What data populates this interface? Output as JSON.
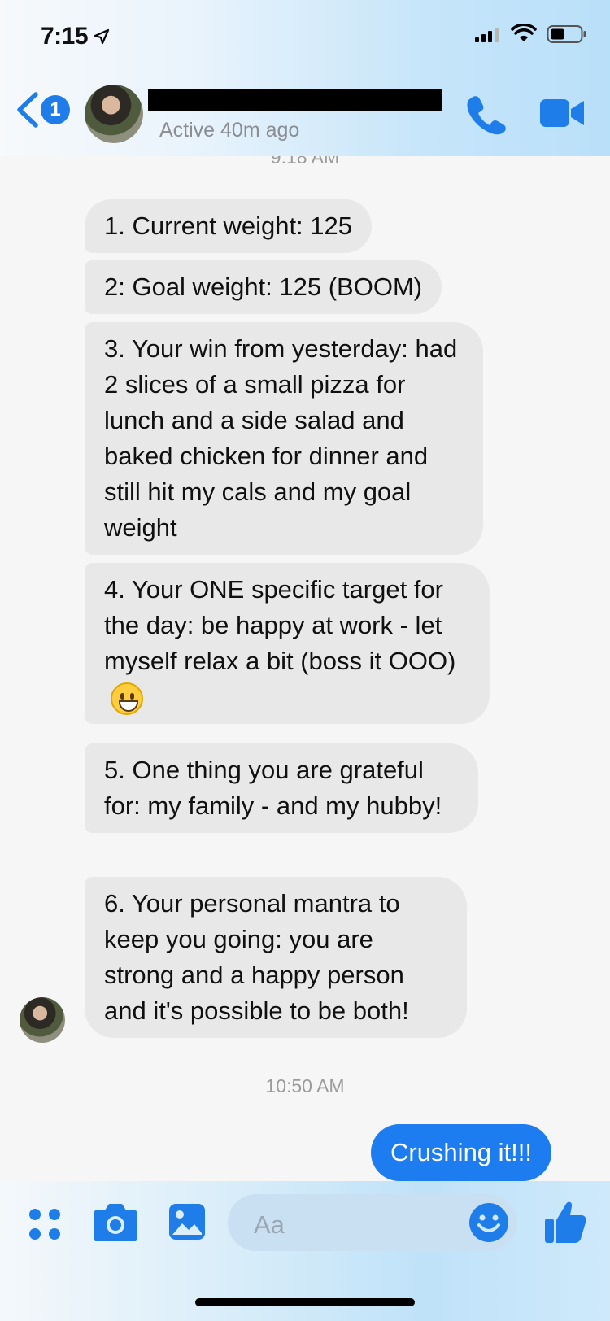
{
  "status_bar": {
    "time": "7:15"
  },
  "header": {
    "back_badge": "1",
    "active_status": "Active 40m ago",
    "icons": [
      "back-chevron-icon",
      "phone-icon",
      "video-icon"
    ]
  },
  "conversation": {
    "timestamp_1": "9:18 AM",
    "messages_received": [
      "1. Current weight: 125",
      "2: Goal weight: 125 (BOOM)",
      "3. Your win from yesterday: had 2 slices of a small pizza for lunch and a side salad and baked chicken for dinner and still hit my cals and my goal weight",
      "4. Your ONE specific target for the day: be happy at work - let myself relax a bit (boss it OOO)",
      "5. One thing you are grateful for: my family - and my hubby!",
      "6. Your personal mantra to keep you going: you are strong and a happy person and it's possible to be both!"
    ],
    "timestamp_2": "10:50 AM",
    "message_sent": "Crushing it!!!"
  },
  "composer": {
    "placeholder": "Aa",
    "icons": [
      "apps-icon",
      "camera-icon",
      "gallery-icon",
      "emoji-icon",
      "thumbs-up-icon"
    ]
  },
  "colors": {
    "accent": "#1e7de8",
    "incoming_bubble": "#e8e8e8",
    "outgoing_bubble": "#1d7cf0"
  }
}
